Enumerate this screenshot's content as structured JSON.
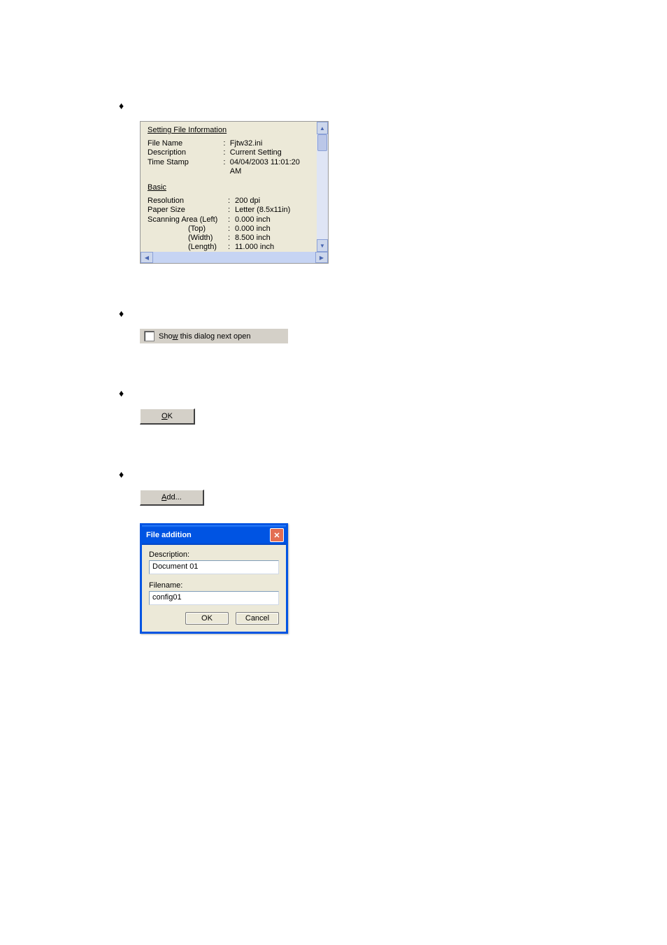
{
  "info_panel": {
    "heading1": "Setting File Information",
    "rows1": [
      {
        "label": "File Name",
        "value": "Fjtw32.ini"
      },
      {
        "label": "Description",
        "value": "Current Setting"
      },
      {
        "label": "Time Stamp",
        "value": "04/04/2003 11:01:20 AM"
      }
    ],
    "heading2": "Basic",
    "rows2": [
      {
        "label": "Resolution",
        "value": "200 dpi"
      },
      {
        "label": "Paper Size",
        "value": "Letter (8.5x11in)"
      },
      {
        "label": "Scanning Area (Left)",
        "value": "0.000 inch"
      },
      {
        "label": "(Top)",
        "value": "0.000 inch",
        "indent": true
      },
      {
        "label": "(Width)",
        "value": "8.500 inch",
        "indent": true
      },
      {
        "label": "(Length)",
        "value": "11.000 inch",
        "indent": true
      }
    ]
  },
  "checkbox": {
    "pre": "Sho",
    "u": "w",
    "post": " this dialog next open",
    "checked": false
  },
  "ok_button": {
    "u": "O",
    "rest": "K"
  },
  "add_button": {
    "u": "A",
    "rest": "dd..."
  },
  "dialog": {
    "title": "File addition",
    "desc_label": "Description:",
    "desc_value": "Document 01",
    "file_label": "Filename:",
    "file_value": "config01",
    "ok": "OK",
    "cancel": "Cancel"
  }
}
